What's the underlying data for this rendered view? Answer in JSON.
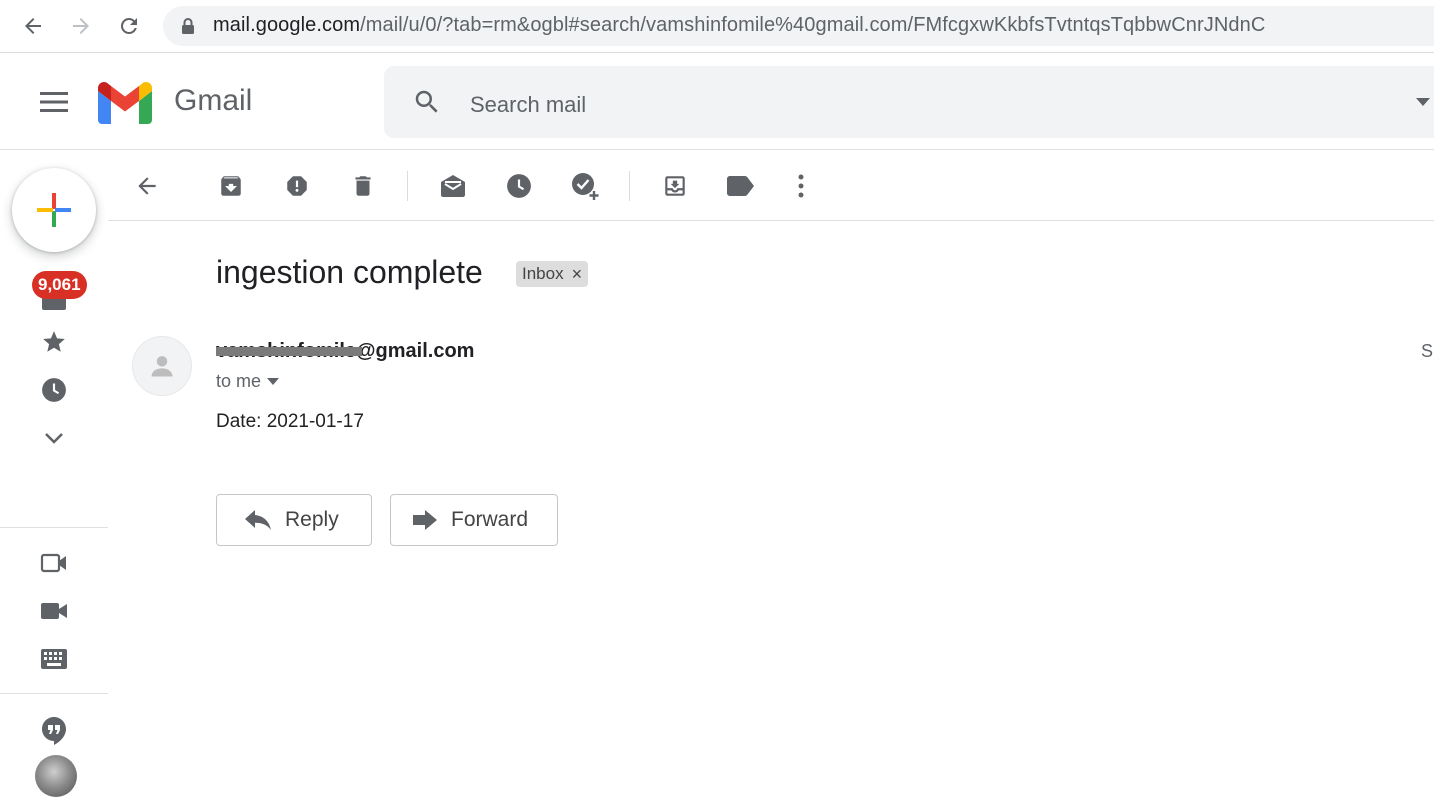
{
  "browser": {
    "url_host": "mail.google.com",
    "url_rest": "/mail/u/0/?tab=rm&ogbl#search/vamshinfomile%40gmail.com/FMfcgxwKkbfsTvtntqsTqbbwCnrJNdnC"
  },
  "header": {
    "app_name": "Gmail",
    "search_placeholder": "Search mail"
  },
  "rail": {
    "unread_count": "9,061",
    "icons": [
      "compose-plus-icon",
      "inbox-icon",
      "star-icon",
      "clock-icon",
      "expand-more-icon",
      "new-meeting-icon",
      "join-meeting-icon",
      "keyboard-icon",
      "hangouts-icon"
    ]
  },
  "toolbar": {
    "icons": [
      "back-arrow-icon",
      "archive-icon",
      "report-spam-icon",
      "delete-icon",
      "mark-unread-icon",
      "snooze-icon",
      "add-to-tasks-icon",
      "move-to-icon",
      "label-icon",
      "more-options-icon"
    ]
  },
  "message": {
    "subject": "ingestion complete",
    "label": "Inbox",
    "label_remove": "×",
    "sender": "vamshinfomile@gmail.com",
    "recipient": "to me",
    "body": "Date: 2021-01-17",
    "side_clip": "S"
  },
  "actions": {
    "reply": "Reply",
    "forward": "Forward"
  },
  "colors": {
    "badge": "#d93025",
    "icon": "#5f6368"
  }
}
